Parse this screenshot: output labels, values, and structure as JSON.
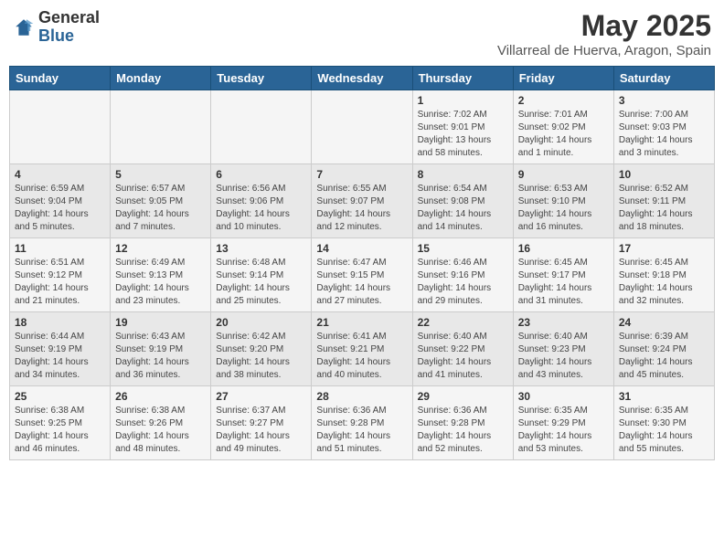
{
  "logo": {
    "general": "General",
    "blue": "Blue"
  },
  "title": "May 2025",
  "location": "Villarreal de Huerva, Aragon, Spain",
  "days_of_week": [
    "Sunday",
    "Monday",
    "Tuesday",
    "Wednesday",
    "Thursday",
    "Friday",
    "Saturday"
  ],
  "weeks": [
    [
      {
        "day": "",
        "content": ""
      },
      {
        "day": "",
        "content": ""
      },
      {
        "day": "",
        "content": ""
      },
      {
        "day": "",
        "content": ""
      },
      {
        "day": "1",
        "content": "Sunrise: 7:02 AM\nSunset: 9:01 PM\nDaylight: 13 hours\nand 58 minutes."
      },
      {
        "day": "2",
        "content": "Sunrise: 7:01 AM\nSunset: 9:02 PM\nDaylight: 14 hours\nand 1 minute."
      },
      {
        "day": "3",
        "content": "Sunrise: 7:00 AM\nSunset: 9:03 PM\nDaylight: 14 hours\nand 3 minutes."
      }
    ],
    [
      {
        "day": "4",
        "content": "Sunrise: 6:59 AM\nSunset: 9:04 PM\nDaylight: 14 hours\nand 5 minutes."
      },
      {
        "day": "5",
        "content": "Sunrise: 6:57 AM\nSunset: 9:05 PM\nDaylight: 14 hours\nand 7 minutes."
      },
      {
        "day": "6",
        "content": "Sunrise: 6:56 AM\nSunset: 9:06 PM\nDaylight: 14 hours\nand 10 minutes."
      },
      {
        "day": "7",
        "content": "Sunrise: 6:55 AM\nSunset: 9:07 PM\nDaylight: 14 hours\nand 12 minutes."
      },
      {
        "day": "8",
        "content": "Sunrise: 6:54 AM\nSunset: 9:08 PM\nDaylight: 14 hours\nand 14 minutes."
      },
      {
        "day": "9",
        "content": "Sunrise: 6:53 AM\nSunset: 9:10 PM\nDaylight: 14 hours\nand 16 minutes."
      },
      {
        "day": "10",
        "content": "Sunrise: 6:52 AM\nSunset: 9:11 PM\nDaylight: 14 hours\nand 18 minutes."
      }
    ],
    [
      {
        "day": "11",
        "content": "Sunrise: 6:51 AM\nSunset: 9:12 PM\nDaylight: 14 hours\nand 21 minutes."
      },
      {
        "day": "12",
        "content": "Sunrise: 6:49 AM\nSunset: 9:13 PM\nDaylight: 14 hours\nand 23 minutes."
      },
      {
        "day": "13",
        "content": "Sunrise: 6:48 AM\nSunset: 9:14 PM\nDaylight: 14 hours\nand 25 minutes."
      },
      {
        "day": "14",
        "content": "Sunrise: 6:47 AM\nSunset: 9:15 PM\nDaylight: 14 hours\nand 27 minutes."
      },
      {
        "day": "15",
        "content": "Sunrise: 6:46 AM\nSunset: 9:16 PM\nDaylight: 14 hours\nand 29 minutes."
      },
      {
        "day": "16",
        "content": "Sunrise: 6:45 AM\nSunset: 9:17 PM\nDaylight: 14 hours\nand 31 minutes."
      },
      {
        "day": "17",
        "content": "Sunrise: 6:45 AM\nSunset: 9:18 PM\nDaylight: 14 hours\nand 32 minutes."
      }
    ],
    [
      {
        "day": "18",
        "content": "Sunrise: 6:44 AM\nSunset: 9:19 PM\nDaylight: 14 hours\nand 34 minutes."
      },
      {
        "day": "19",
        "content": "Sunrise: 6:43 AM\nSunset: 9:19 PM\nDaylight: 14 hours\nand 36 minutes."
      },
      {
        "day": "20",
        "content": "Sunrise: 6:42 AM\nSunset: 9:20 PM\nDaylight: 14 hours\nand 38 minutes."
      },
      {
        "day": "21",
        "content": "Sunrise: 6:41 AM\nSunset: 9:21 PM\nDaylight: 14 hours\nand 40 minutes."
      },
      {
        "day": "22",
        "content": "Sunrise: 6:40 AM\nSunset: 9:22 PM\nDaylight: 14 hours\nand 41 minutes."
      },
      {
        "day": "23",
        "content": "Sunrise: 6:40 AM\nSunset: 9:23 PM\nDaylight: 14 hours\nand 43 minutes."
      },
      {
        "day": "24",
        "content": "Sunrise: 6:39 AM\nSunset: 9:24 PM\nDaylight: 14 hours\nand 45 minutes."
      }
    ],
    [
      {
        "day": "25",
        "content": "Sunrise: 6:38 AM\nSunset: 9:25 PM\nDaylight: 14 hours\nand 46 minutes."
      },
      {
        "day": "26",
        "content": "Sunrise: 6:38 AM\nSunset: 9:26 PM\nDaylight: 14 hours\nand 48 minutes."
      },
      {
        "day": "27",
        "content": "Sunrise: 6:37 AM\nSunset: 9:27 PM\nDaylight: 14 hours\nand 49 minutes."
      },
      {
        "day": "28",
        "content": "Sunrise: 6:36 AM\nSunset: 9:28 PM\nDaylight: 14 hours\nand 51 minutes."
      },
      {
        "day": "29",
        "content": "Sunrise: 6:36 AM\nSunset: 9:28 PM\nDaylight: 14 hours\nand 52 minutes."
      },
      {
        "day": "30",
        "content": "Sunrise: 6:35 AM\nSunset: 9:29 PM\nDaylight: 14 hours\nand 53 minutes."
      },
      {
        "day": "31",
        "content": "Sunrise: 6:35 AM\nSunset: 9:30 PM\nDaylight: 14 hours\nand 55 minutes."
      }
    ]
  ]
}
